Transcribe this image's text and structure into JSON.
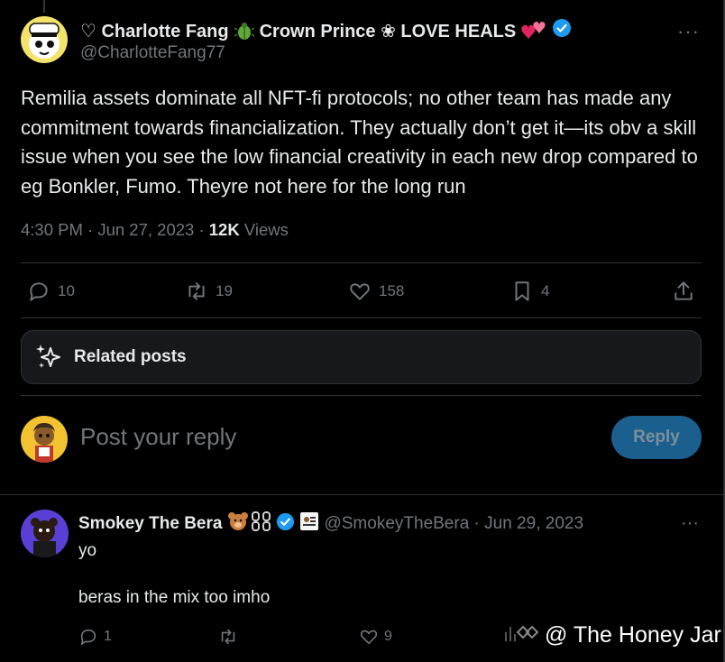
{
  "tweet": {
    "author_name": "♡ Charlotte Fang",
    "author_name_mid": "Crown Prince ❀ LOVE HEALS",
    "handle": "@CharlotteFang77",
    "more": "···",
    "text": "Remilia assets dominate all NFT-fi protocols; no other team has made any commitment towards financialization. They actually don’t get it—its obv a skill issue when you see the low financial creativity in each new drop compared to eg Bonkler, Fumo. Theyre not here for the long run",
    "time": "4:30 PM · Jun 27, 2023 · ",
    "views_count": "12K",
    "views_label": " Views",
    "replies": "10",
    "reposts": "19",
    "likes": "158",
    "bookmarks": "4"
  },
  "related": {
    "label": "Related posts"
  },
  "reply_box": {
    "placeholder": "Post your reply",
    "button": "Reply"
  },
  "comment": {
    "name": "Smokey The Bera",
    "handle_date": "@SmokeyTheBera · Jun 29, 2023",
    "more": "···",
    "text1": "yo",
    "text2": "beras in the mix too imho",
    "replies": "1",
    "likes": "9"
  },
  "watermark": {
    "text": "@ The Honey Jar"
  },
  "colors": {
    "verified": "#1d9bf0",
    "reply_button": "#1a5f8e",
    "muted": "#71767b"
  }
}
